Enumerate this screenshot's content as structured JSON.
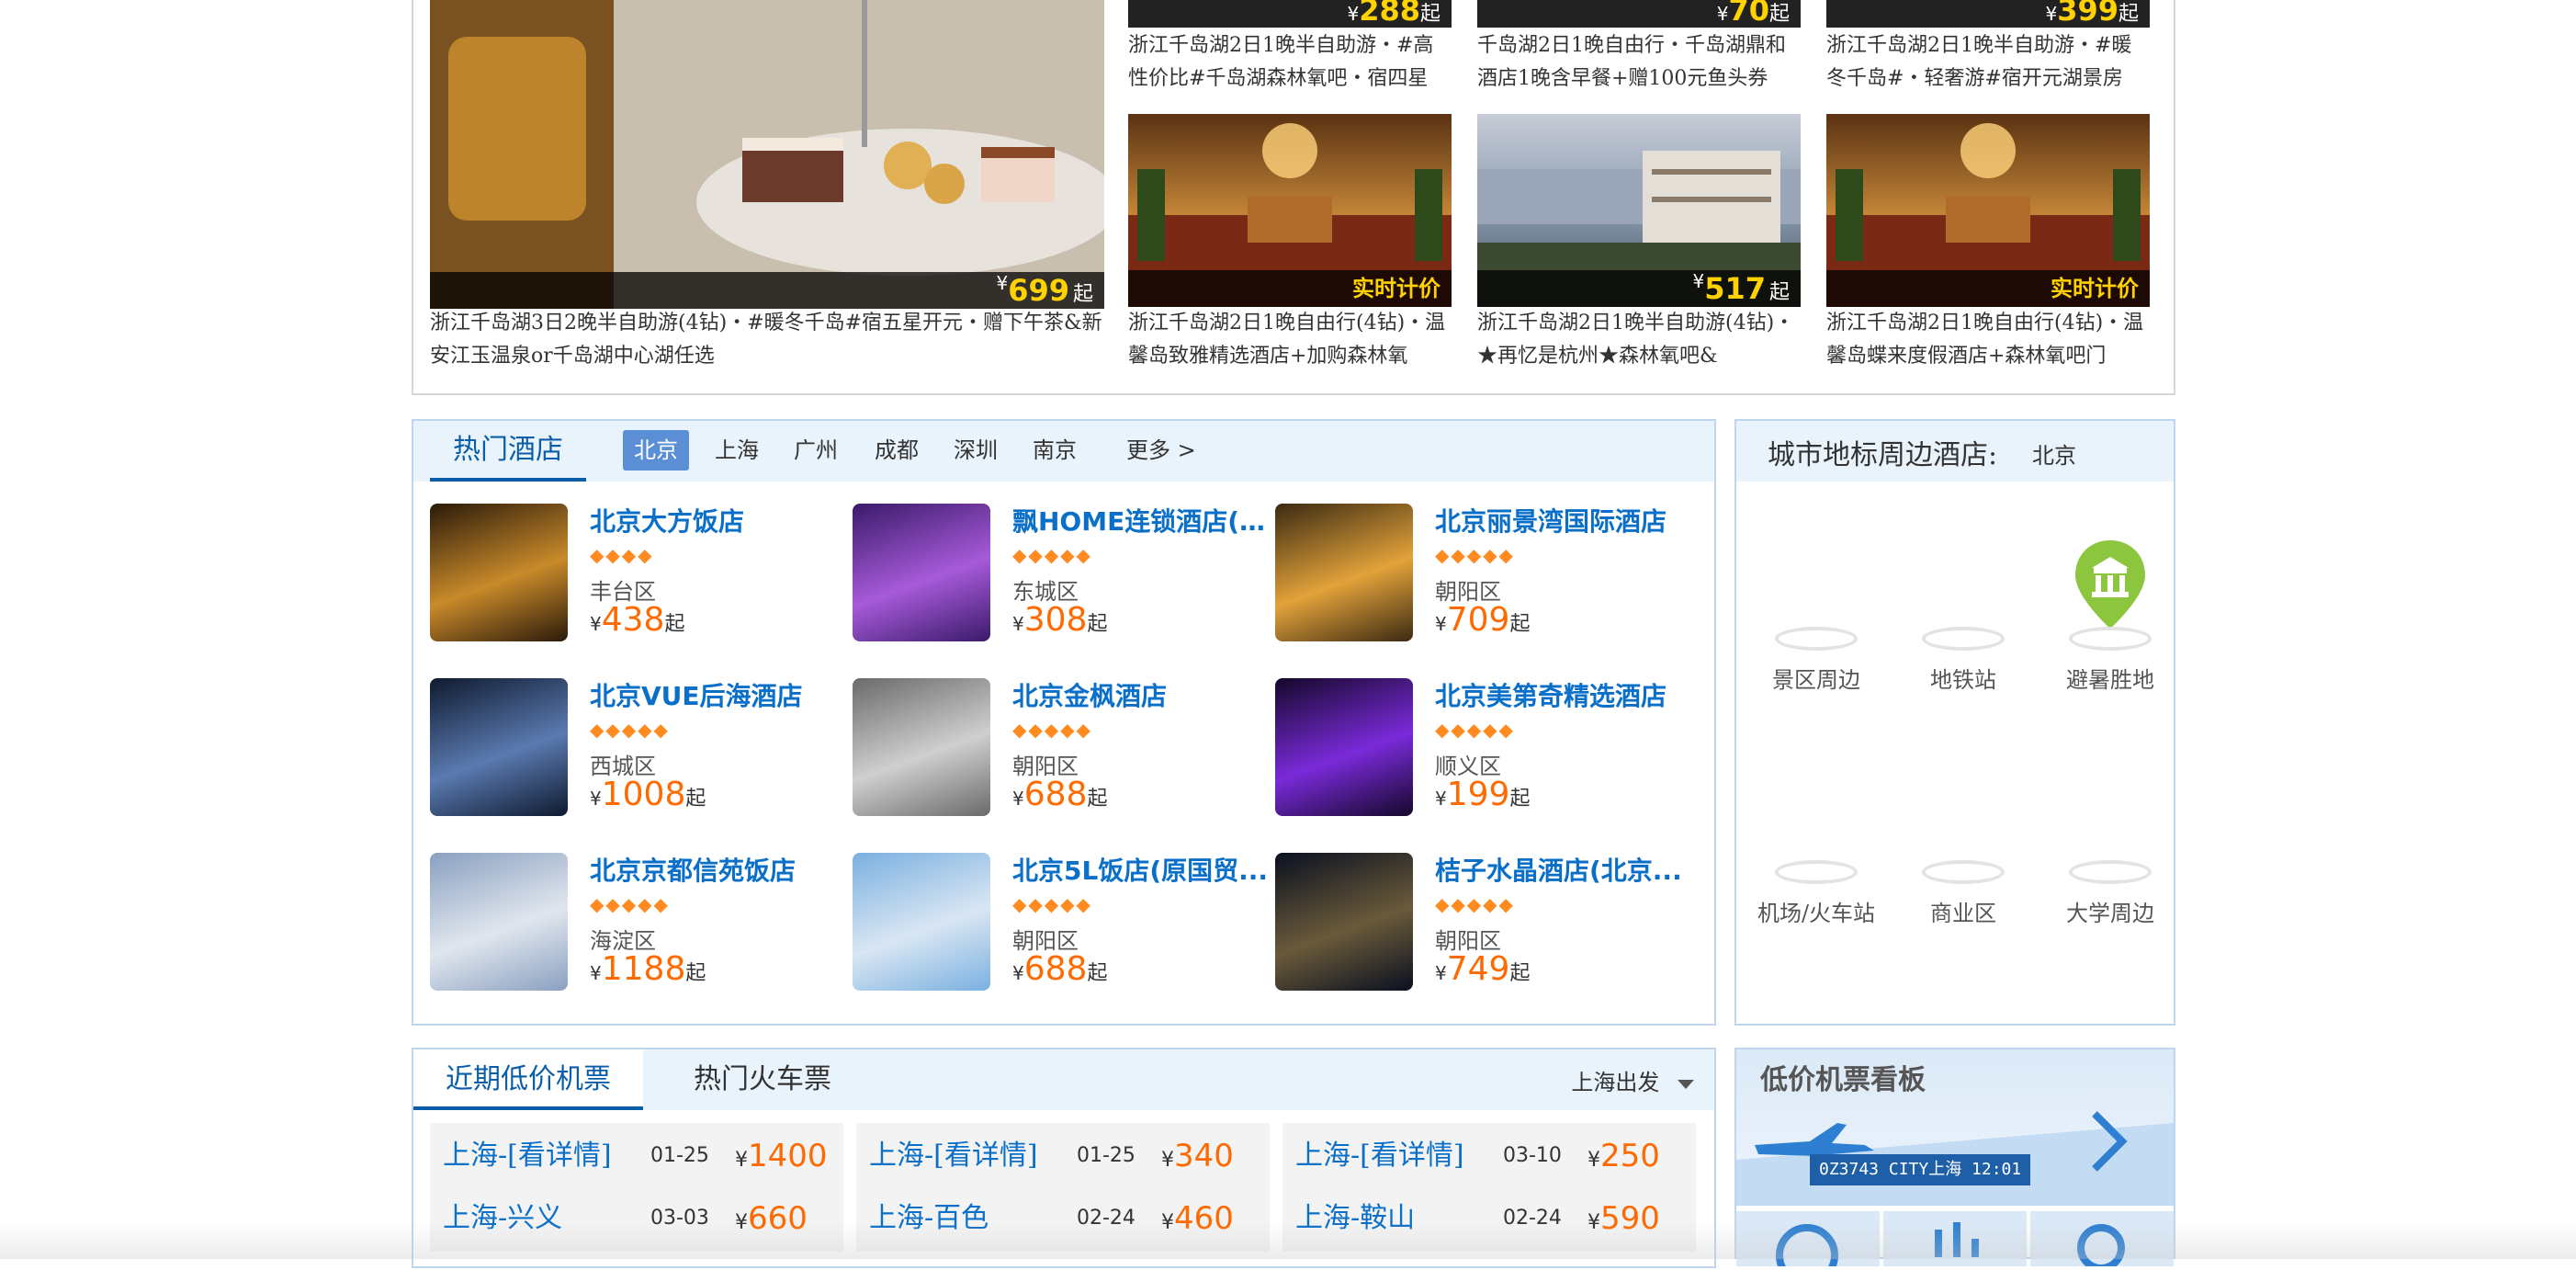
{
  "packages": {
    "top_prices": [
      "288",
      "70",
      "399"
    ],
    "top_descs": [
      "浙江千岛湖2日1晚半自助游・#高性价比#千岛湖森林氧吧・宿四星",
      "千岛湖2日1晚自由行・千岛湖鼎和酒店1晚含早餐+赠100元鱼头券",
      "浙江千岛湖2日1晚半自助游・#暖冬千岛#・轻奢游#宿开元湖景房"
    ],
    "featured": {
      "price": "699",
      "desc": "浙江千岛湖3日2晚半自助游(4钻)・#暖冬千岛#宿五星开元・赠下午茶&新安江玉温泉or千岛湖中心湖任选"
    },
    "items": [
      {
        "price_label": "实时计价",
        "desc": "浙江千岛湖2日1晚自由行(4钻)・温馨岛致雅精选酒店+加购森林氧"
      },
      {
        "price": "517",
        "desc": "浙江千岛湖2日1晚半自助游(4钻)・★再忆是杭州★森林氧吧&"
      },
      {
        "price_label": "实时计价",
        "desc": "浙江千岛湖2日1晚自由行(4钻)・温馨岛蝶来度假酒店+森林氧吧门"
      }
    ],
    "currency": "¥",
    "from": "起"
  },
  "hot_hotels": {
    "title": "热门酒店",
    "cities": [
      "北京",
      "上海",
      "广州",
      "成都",
      "深圳",
      "南京"
    ],
    "more": "更多 >",
    "hotels": [
      {
        "name": "北京大方饭店",
        "stars": 4,
        "district": "丰台区",
        "price": "438"
      },
      {
        "name": "飘HOME连锁酒店(北京...",
        "stars": 5,
        "district": "东城区",
        "price": "308"
      },
      {
        "name": "北京丽景湾国际酒店",
        "stars": 5,
        "district": "朝阳区",
        "price": "709"
      },
      {
        "name": "北京VUE后海酒店",
        "stars": 5,
        "district": "西城区",
        "price": "1008"
      },
      {
        "name": "北京金枫酒店",
        "stars": 5,
        "district": "朝阳区",
        "price": "688"
      },
      {
        "name": "北京美第奇精选酒店",
        "stars": 5,
        "district": "顺义区",
        "price": "199"
      },
      {
        "name": "北京京都信苑饭店",
        "stars": 5,
        "district": "海淀区",
        "price": "1188"
      },
      {
        "name": "北京5L饭店(原国贸...",
        "stars": 5,
        "district": "朝阳区",
        "price": "688"
      },
      {
        "name": "桔子水晶酒店(北京...",
        "stars": 5,
        "district": "朝阳区",
        "price": "749"
      }
    ]
  },
  "landmarks": {
    "title": "城市地标周边酒店:",
    "city": "北京",
    "items": [
      "景区周边",
      "地铁站",
      "避暑胜地",
      "机场/火车站",
      "商业区",
      "大学周边"
    ]
  },
  "flights": {
    "tab_active": "近期低价机票",
    "tab_other": "热门火车票",
    "departure": "上海出发",
    "rows": [
      {
        "route": "上海-[看详情]",
        "date": "01-25",
        "price": "1400"
      },
      {
        "route": "上海-[看详情]",
        "date": "01-25",
        "price": "340"
      },
      {
        "route": "上海-[看详情]",
        "date": "03-10",
        "price": "250"
      },
      {
        "route": "上海-兴义",
        "date": "03-03",
        "price": "660"
      },
      {
        "route": "上海-百色",
        "date": "02-24",
        "price": "460"
      },
      {
        "route": "上海-鞍山",
        "date": "02-24",
        "price": "590"
      }
    ]
  },
  "board": {
    "title": "低价机票看板",
    "ticker": "0Z3743  CITY上海 12:01"
  }
}
